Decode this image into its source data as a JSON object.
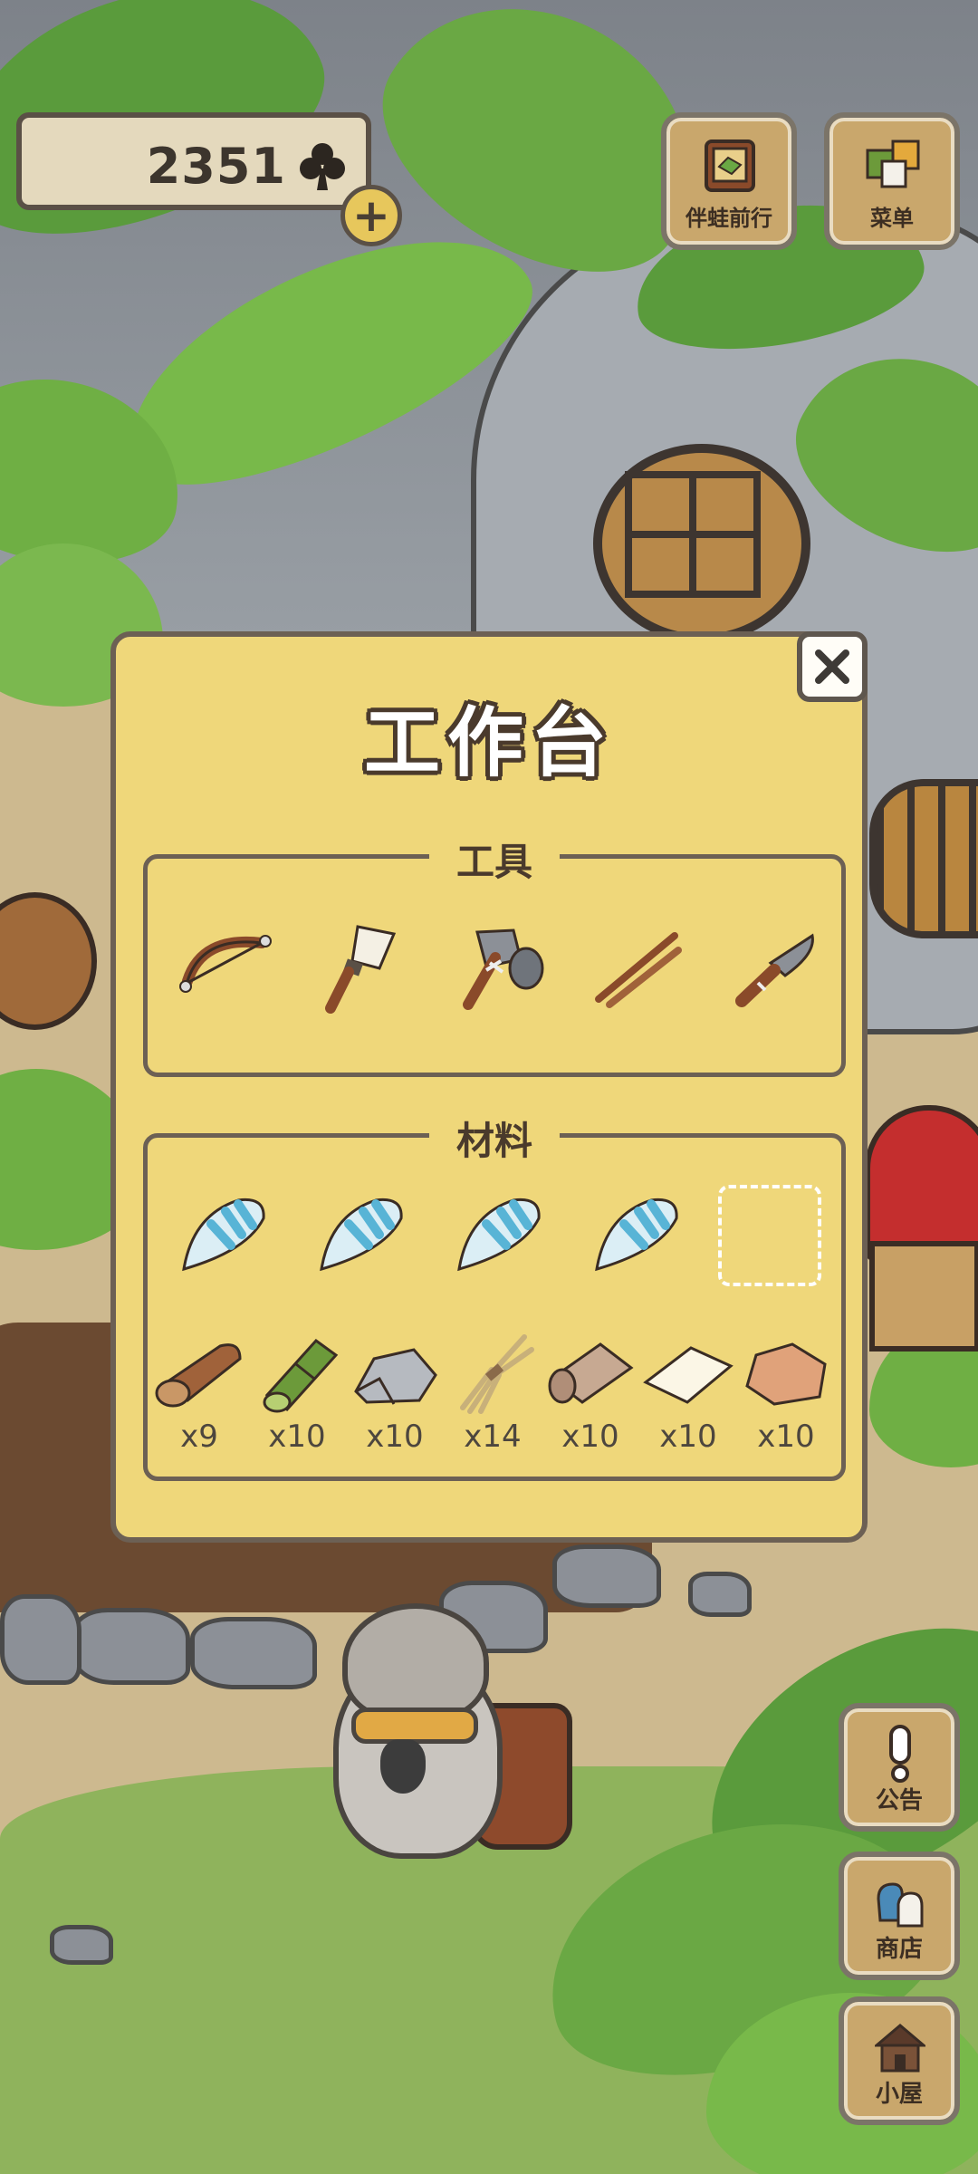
{
  "currency": {
    "amount": "2351",
    "icon": "clover-icon",
    "add_label": "+"
  },
  "top_buttons": [
    {
      "name": "travel-companion-button",
      "label": "伴蛙前行",
      "icon": "map-book-icon"
    },
    {
      "name": "menu-button",
      "label": "菜单",
      "icon": "menu-cards-icon"
    }
  ],
  "side_buttons": [
    {
      "name": "notice-button",
      "label": "公告",
      "icon": "exclamation-icon"
    },
    {
      "name": "shop-button",
      "label": "商店",
      "icon": "shop-bags-icon"
    },
    {
      "name": "house-button",
      "label": "小屋",
      "icon": "house-icon"
    }
  ],
  "workbench": {
    "title": "工作台",
    "close_icon": "close-icon",
    "tools_section": {
      "title": "工具",
      "items": [
        "bow-icon",
        "brush-icon",
        "stone-axe-icon",
        "sticks-icon",
        "knife-icon"
      ]
    },
    "materials_section": {
      "title": "材料",
      "shells": [
        "shell-icon",
        "shell-icon",
        "shell-icon",
        "shell-icon"
      ],
      "empty_slot": true,
      "items": [
        {
          "icon": "log-icon",
          "qty": "x9"
        },
        {
          "icon": "bamboo-icon",
          "qty": "x10"
        },
        {
          "icon": "stone-icon",
          "qty": "x10"
        },
        {
          "icon": "straw-icon",
          "qty": "x14"
        },
        {
          "icon": "cloth-roll-icon",
          "qty": "x10"
        },
        {
          "icon": "paper-icon",
          "qty": "x10"
        },
        {
          "icon": "leather-icon",
          "qty": "x10"
        }
      ]
    }
  },
  "colors": {
    "panel": "#efd77a",
    "panel_border": "#6c6054",
    "button_wood": "#c9a76c",
    "shell_blue": "#58b4d6"
  }
}
